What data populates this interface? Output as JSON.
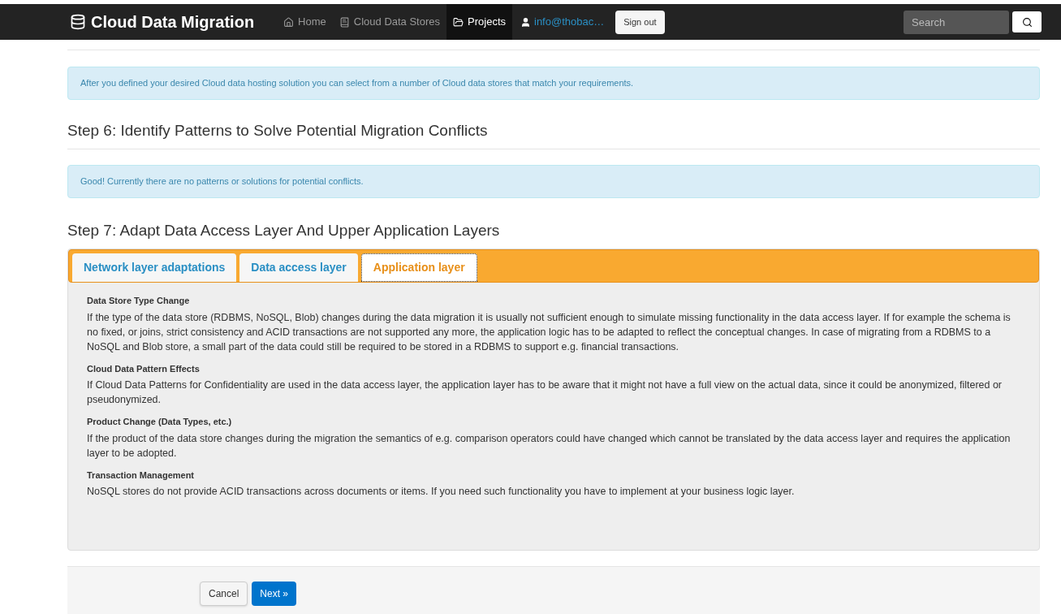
{
  "navbar": {
    "brand": "Cloud Data Migration",
    "items": [
      {
        "label": "Home",
        "kind": "home",
        "selected": false
      },
      {
        "label": "Cloud Data Stores",
        "kind": "stores",
        "selected": false
      },
      {
        "label": "Projects",
        "kind": "projects",
        "selected": true
      }
    ],
    "user": "info@thobac…",
    "sign_out": "Sign out",
    "search": {
      "placeholder": "Search"
    }
  },
  "alerts": [
    {
      "text": "After you defined your desired Cloud data hosting solution you can select from a number of Cloud data stores that match your requirements."
    }
  ],
  "sections": [
    {
      "title": "Step 6: Identify Patterns to Solve Potential Migration Conflicts",
      "alert": "Good! Currently there are no patterns or solutions for potential conflicts."
    }
  ],
  "step7": {
    "title": "Step 7: Adapt Data Access Layer And Upper Application Layers",
    "tabs": [
      {
        "label": "Network layer adaptations",
        "selected": false
      },
      {
        "label": "Data access layer",
        "selected": false
      },
      {
        "label": "Application layer",
        "selected": true
      }
    ],
    "entries": [
      {
        "heading": "Data Store Type Change",
        "text": "If the type of the data store (RDBMS, NoSQL, Blob) changes during the data migration it is usually not sufficient enough to simulate missing functionality in the data access layer. If for example the schema is no fixed, or joins, strict consistency and ACID transactions are not supported any more, the application logic has to be adapted to reflect the conceptual changes. In case of migrating from a RDBMS to a NoSQL and Blob store, a small part of the data could still be required to be stored in a RDBMS to support e.g. financial transactions."
      },
      {
        "heading": "Cloud Data Pattern Effects",
        "text": "If Cloud Data Patterns for Confidentiality are used in the data access layer, the application layer has to be aware that it might not have a full view on the actual data, since it could be anonymized, filtered or pseudonymized."
      },
      {
        "heading": "Product Change (Data Types, etc.)",
        "text": "If the product of the data store changes during the migration the semantics of e.g. comparison operators could have changed which cannot be translated by the data access layer and requires the application layer to be adopted."
      },
      {
        "heading": "Transaction Management",
        "text": "NoSQL stores do not provide ACID transactions across documents or items. If you need such functionality you have to implement at your business logic layer."
      }
    ]
  },
  "footer": {
    "cancel": "Cancel",
    "next": "Next »"
  }
}
